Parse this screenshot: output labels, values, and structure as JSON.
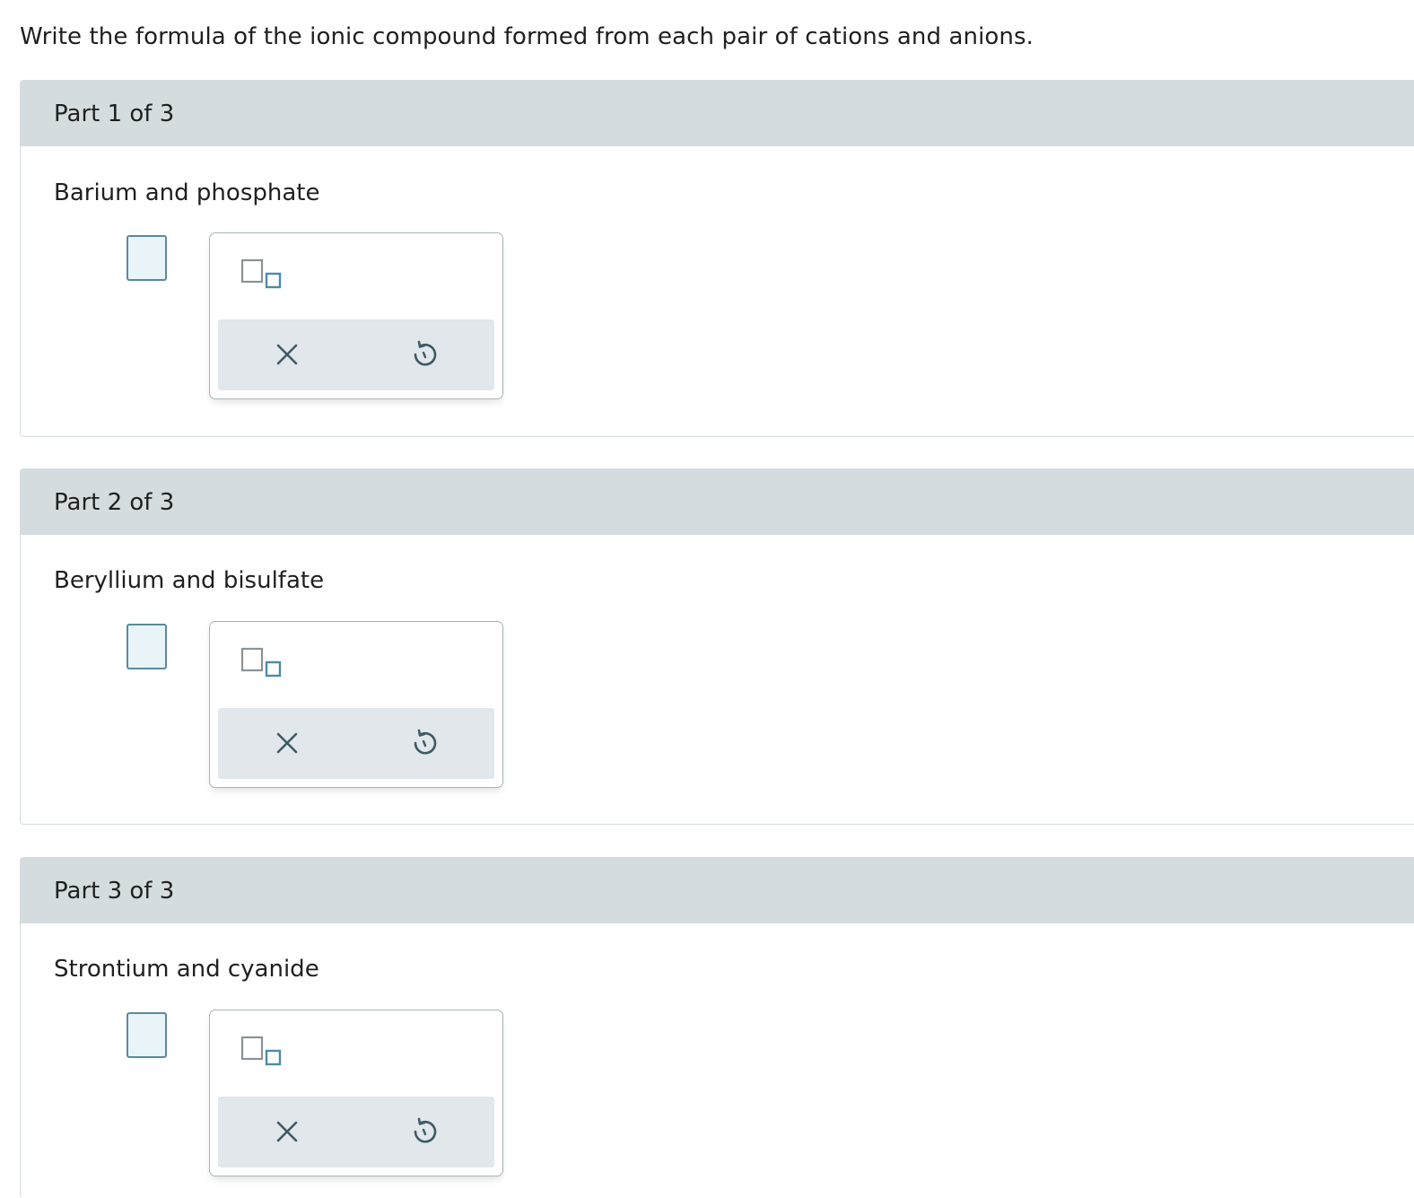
{
  "instruction": "Write the formula of the ionic compound formed from each pair of cations and anions.",
  "parts": [
    {
      "header": "Part 1 of 3",
      "prompt": "Barium and phosphate"
    },
    {
      "header": "Part 2 of 3",
      "prompt": "Beryllium and bisulfate"
    },
    {
      "header": "Part 3 of 3",
      "prompt": "Strontium and cyanide"
    }
  ],
  "icons": {
    "subscript_tool": "subscript-template-icon",
    "clear": "close-icon",
    "undo": "undo-icon"
  },
  "colors": {
    "header_bg": "#d5dcdf",
    "action_bar_bg": "#e1e7ea",
    "answer_box_border": "#5a8a9e",
    "answer_box_fill": "#e8f4f8",
    "icon_color": "#3f5965"
  }
}
